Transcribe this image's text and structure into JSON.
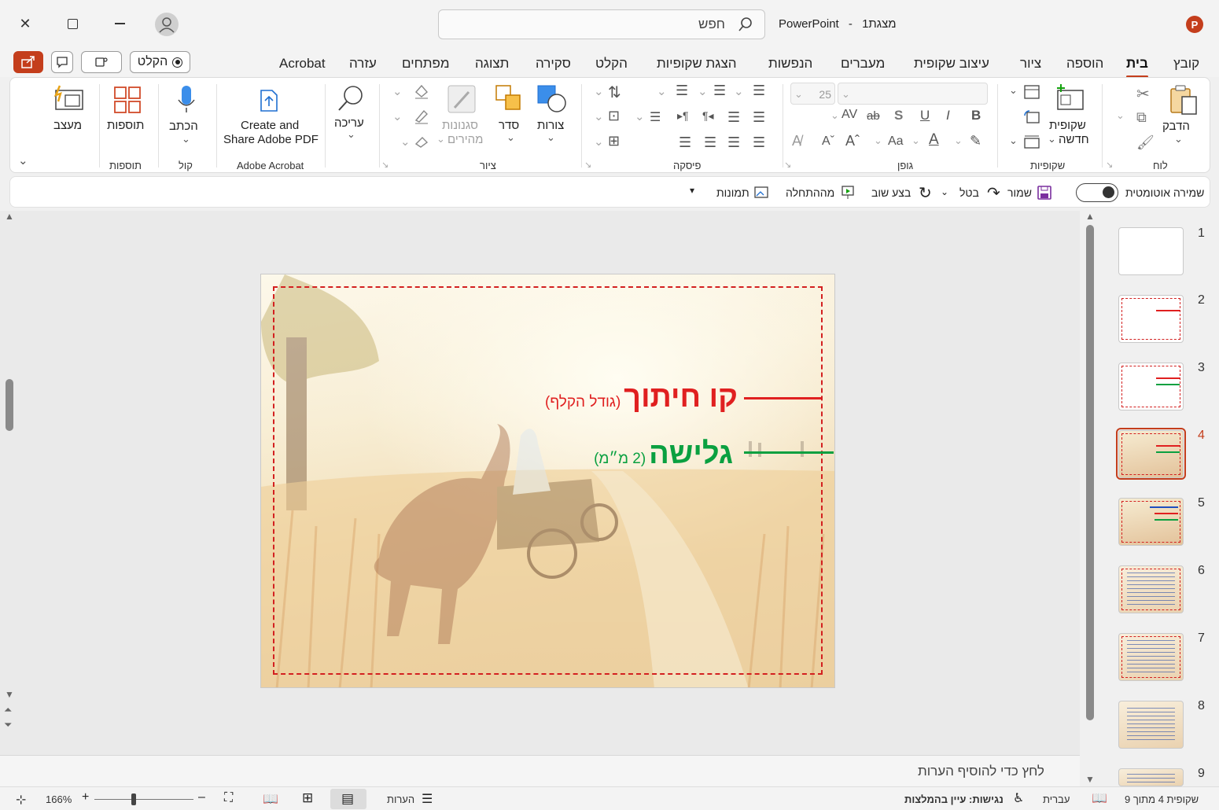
{
  "window": {
    "app_name": "PowerPoint",
    "doc_name": "מצגת1",
    "separator": "-"
  },
  "search": {
    "placeholder": "חפש"
  },
  "tabs": [
    {
      "label": "קובץ"
    },
    {
      "label": "בית"
    },
    {
      "label": "הוספה"
    },
    {
      "label": "ציור"
    },
    {
      "label": "עיצוב שקופית"
    },
    {
      "label": "מעברים"
    },
    {
      "label": "הנפשות"
    },
    {
      "label": "הצגת שקופיות"
    },
    {
      "label": "הקלט"
    },
    {
      "label": "סקירה"
    },
    {
      "label": "תצוגה"
    },
    {
      "label": "מפתחים"
    },
    {
      "label": "עזרה"
    },
    {
      "label": "Acrobat"
    }
  ],
  "record_button": "הקלט",
  "ribbon": {
    "clipboard": {
      "group": "לוח",
      "paste": "הדבק"
    },
    "slides": {
      "group": "שקופיות",
      "new_slide_1": "שקופית",
      "new_slide_2": "חדשה"
    },
    "font": {
      "group": "גופן",
      "size": "25",
      "case": "Aa"
    },
    "paragraph": {
      "group": "פיסקה"
    },
    "drawing": {
      "group": "ציור",
      "shapes": "צורות",
      "arrange": "סדר",
      "quick_styles_1": "סגנונות",
      "quick_styles_2": "מהירים"
    },
    "editing": {
      "label": "עריכה"
    },
    "acrobat": {
      "group": "Adobe Acrobat",
      "line1": "Create and",
      "line2": "Share Adobe PDF"
    },
    "voice": {
      "group": "קול",
      "dictate": "הכתב"
    },
    "addins": {
      "group": "תוספות",
      "label": "תוספות"
    },
    "designer": {
      "label": "מעצב"
    }
  },
  "qat": {
    "autosave": "שמירה אוטומטית",
    "save": "שמור",
    "undo": "בטל",
    "redo": "בצע שוב",
    "from_beginning": "מההתחלה",
    "pictures": "תמונות"
  },
  "slide": {
    "line1_main": "קו חיתוך",
    "line1_note": "(גודל הקלף)",
    "line2_main": "גלישה",
    "line2_note": "(2 מ״מ)",
    "colors": {
      "red": "#e02020",
      "green": "#0aa040",
      "dash": "#d32020"
    }
  },
  "thumbnails": [
    "1",
    "2",
    "3",
    "4",
    "5",
    "6",
    "7",
    "8",
    "9"
  ],
  "selected_slide": "4",
  "notes": {
    "placeholder": "לחץ כדי להוסיף הערות"
  },
  "status": {
    "slide_info": "שקופית 4 מתוך 9",
    "language": "עברית",
    "accessibility": "נגישות: עיין בהמלצות",
    "notes": "הערות",
    "zoom": "166%"
  }
}
